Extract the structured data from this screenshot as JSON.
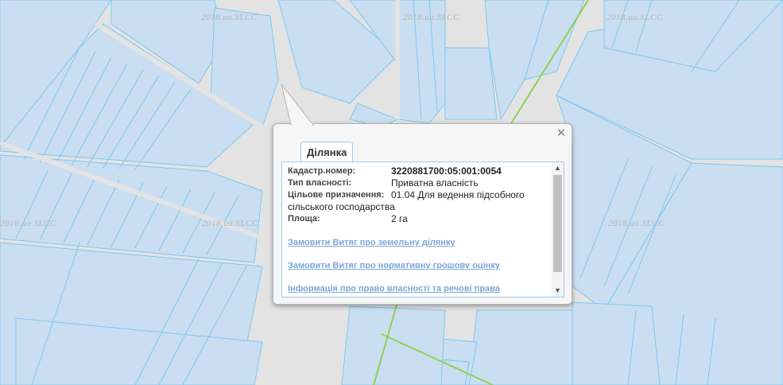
{
  "map": {
    "watermark": "2018.ua.SLCC",
    "colors": {
      "background": "#e3e3e3",
      "parcel_fill": "#c9def0",
      "parcel_stroke": "#7ec8f0",
      "boundary_line": "#8fd14f"
    }
  },
  "popup": {
    "tab_label": "Ділянка",
    "close_icon": "close-icon",
    "fields": {
      "cadastral_label": "Кадастр.номер:",
      "cadastral_value": "3220881700:05:001:0054",
      "ownership_label": "Тип власності:",
      "ownership_value": "Приватна власність",
      "purpose_label": "Цільове призначення:",
      "purpose_value": "01.04 Для ведення підсобного сільського господарства",
      "area_label": "Площа:",
      "area_value": "2 га"
    },
    "links": [
      "Замовити Витяг про земельну ділянку",
      "Замовити Витяг про нормативну грошову оцінку",
      "Інформація про право власності та речові права"
    ]
  }
}
